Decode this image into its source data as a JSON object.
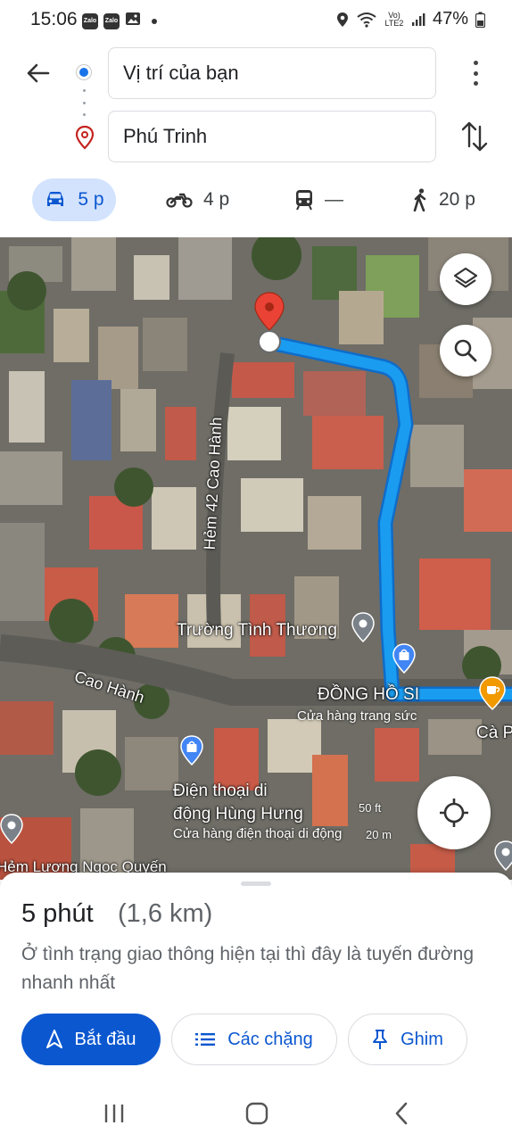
{
  "status_bar": {
    "time": "15:06",
    "app_icons": [
      "Zalo",
      "Zalo"
    ],
    "network": "Vo) LTE2",
    "battery": "47%"
  },
  "directions": {
    "origin": "Vị trí của bạn",
    "destination": "Phú Trinh"
  },
  "modes": [
    {
      "name": "car",
      "label": "5 p"
    },
    {
      "name": "motorbike",
      "label": "4 p"
    },
    {
      "name": "transit",
      "label": "—"
    },
    {
      "name": "walk",
      "label": "20 p"
    }
  ],
  "map": {
    "labels": {
      "alley": "Hẻm 42 Cao Hành",
      "school": "Trường Tình Thương",
      "road": "Cao Hành",
      "watch_shop": "ĐỒNG HỒ SI",
      "watch_shop_type": "Cửa hàng trang sức",
      "phone_shop_line1": "Điện thoại di",
      "phone_shop_line2": "động Hùng Hưng",
      "phone_shop_type": "Cửa hàng điện thoại di động",
      "cafe": "Cà P",
      "street_bottom": "Hẻm Lương Ngọc Quyến"
    },
    "scale_ft": "50 ft",
    "scale_m": "20 m",
    "route_color": "#1a9cf0"
  },
  "sheet": {
    "duration": "5 phút",
    "distance": "(1,6 km)",
    "description": "Ở tình trạng giao thông hiện tại thì đây là tuyến đường nhanh nhất",
    "start_label": "Bắt đầu",
    "steps_label": "Các chặng",
    "pin_label": "Ghim"
  }
}
